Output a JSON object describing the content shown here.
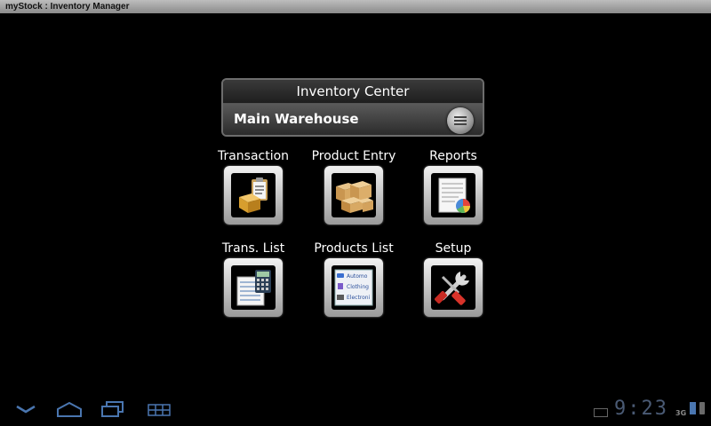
{
  "window": {
    "title": "myStock : Inventory Manager"
  },
  "center": {
    "title": "Inventory Center",
    "warehouse": "Main Warehouse"
  },
  "tiles": [
    {
      "label": "Transaction",
      "icon": "clipboard-box-icon"
    },
    {
      "label": "Product Entry",
      "icon": "boxes-icon"
    },
    {
      "label": "Reports",
      "icon": "report-chart-icon"
    },
    {
      "label": "Trans. List",
      "icon": "calculator-list-icon"
    },
    {
      "label": "Products List",
      "icon": "products-list-icon"
    },
    {
      "label": "Setup",
      "icon": "tools-icon"
    }
  ],
  "products_list_icon": {
    "items": [
      "Automo",
      "Clothing",
      "Electroni"
    ]
  },
  "status": {
    "time": "9:23",
    "network": "3G"
  }
}
